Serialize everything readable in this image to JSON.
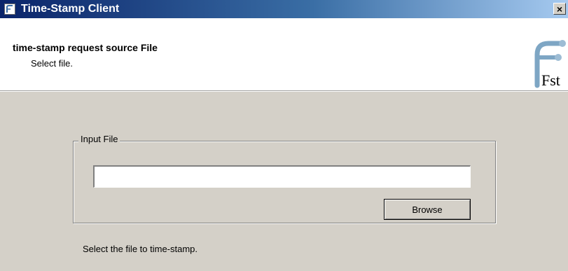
{
  "window": {
    "title": "Time-Stamp Client",
    "close_label": "×"
  },
  "header": {
    "title": "time-stamp request source File",
    "subtitle": "Select file.",
    "logo_text": "Fst"
  },
  "input_group": {
    "label": "Input File",
    "file_value": "",
    "browse_label": "Browse"
  },
  "hint": "Select the file to time-stamp.",
  "icons": {
    "app": "app-icon",
    "close": "close-icon",
    "logo": "fst-logo"
  },
  "colors": {
    "titlebar_start": "#0a246a",
    "titlebar_end": "#a6caf0",
    "dialog_bg": "#d4d0c8",
    "header_bg": "#ffffff"
  }
}
